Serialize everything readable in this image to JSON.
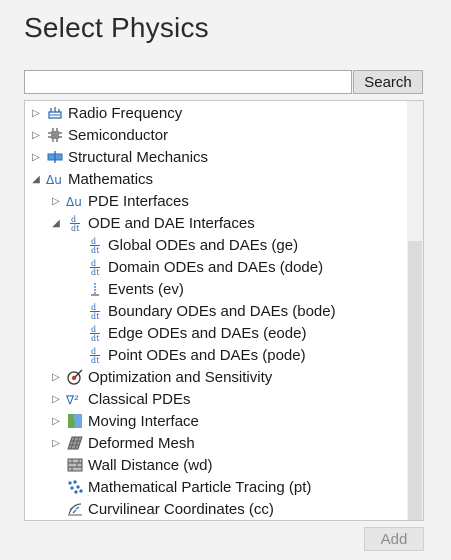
{
  "title": "Select Physics",
  "search": {
    "value": "",
    "placeholder": "",
    "button_label": "Search"
  },
  "tree": [
    {
      "label": "Radio Frequency",
      "icon": "radio-frequency-icon",
      "expander": "collapsed"
    },
    {
      "label": "Semiconductor",
      "icon": "semiconductor-icon",
      "expander": "collapsed"
    },
    {
      "label": "Structural Mechanics",
      "icon": "structural-mechanics-icon",
      "expander": "collapsed"
    },
    {
      "label": "Mathematics",
      "icon": "mathematics-icon",
      "expander": "expanded"
    },
    {
      "label": "PDE Interfaces",
      "icon": "pde-interfaces-icon",
      "expander": "collapsed"
    },
    {
      "label": "ODE and DAE Interfaces",
      "icon": "ode-dae-icon",
      "expander": "expanded"
    },
    {
      "label": "Global ODEs and DAEs (ge)",
      "icon": "ode-dae-icon",
      "expander": "none"
    },
    {
      "label": "Domain ODEs and DAEs (dode)",
      "icon": "ode-dae-icon",
      "expander": "none"
    },
    {
      "label": "Events (ev)",
      "icon": "events-icon",
      "expander": "none"
    },
    {
      "label": "Boundary ODEs and DAEs (bode)",
      "icon": "ode-dae-icon",
      "expander": "none"
    },
    {
      "label": "Edge ODEs and DAEs (eode)",
      "icon": "ode-dae-icon",
      "expander": "none"
    },
    {
      "label": "Point ODEs and DAEs (pode)",
      "icon": "ode-dae-icon",
      "expander": "none"
    },
    {
      "label": "Optimization and Sensitivity",
      "icon": "optimization-icon",
      "expander": "collapsed"
    },
    {
      "label": "Classical PDEs",
      "icon": "classical-pdes-icon",
      "expander": "collapsed"
    },
    {
      "label": "Moving Interface",
      "icon": "moving-interface-icon",
      "expander": "collapsed"
    },
    {
      "label": "Deformed Mesh",
      "icon": "deformed-mesh-icon",
      "expander": "collapsed"
    },
    {
      "label": "Wall Distance (wd)",
      "icon": "wall-distance-icon",
      "expander": "none"
    },
    {
      "label": "Mathematical Particle Tracing (pt)",
      "icon": "particle-tracing-icon",
      "expander": "none"
    },
    {
      "label": "Curvilinear Coordinates (cc)",
      "icon": "curvilinear-coordinates-icon",
      "expander": "none"
    }
  ],
  "add_button_label": "Add",
  "colors": {
    "background": "#f3f3f3",
    "accent_blue": "#2e6db4",
    "disabled_text": "#8c8c8c"
  }
}
